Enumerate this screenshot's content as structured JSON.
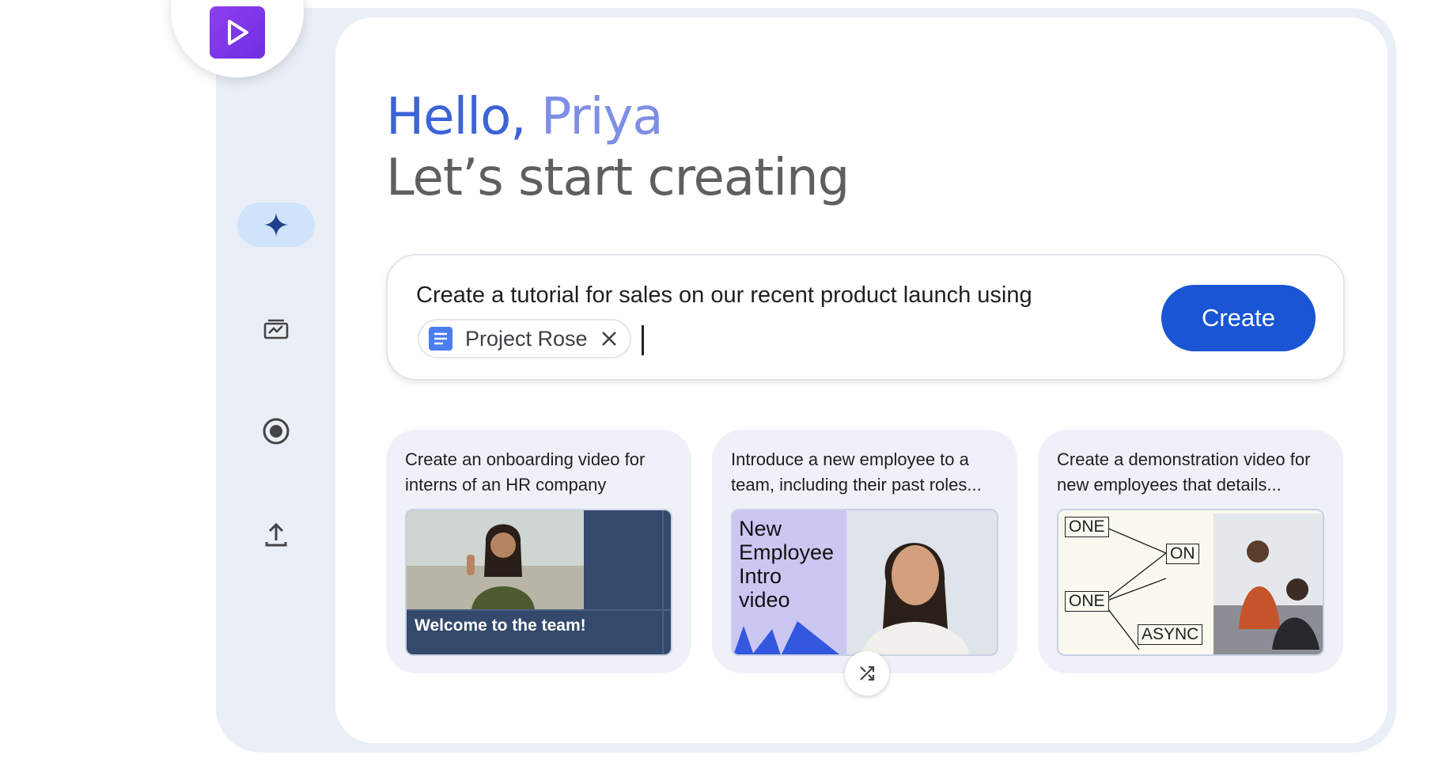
{
  "greeting": {
    "hello": "Hello,",
    "name": "Priya",
    "subtitle": "Let’s start creating"
  },
  "rail": {
    "items": [
      {
        "icon": "sparkle-icon",
        "active": true
      },
      {
        "icon": "edit-gallery-icon",
        "active": false
      },
      {
        "icon": "record-icon",
        "active": false
      },
      {
        "icon": "upload-icon",
        "active": false
      }
    ]
  },
  "prompt": {
    "text": "Create a tutorial for sales on our recent product launch using",
    "chip_label": "Project Rose",
    "create_label": "Create"
  },
  "suggestions": [
    {
      "text": "Create an onboarding video for interns of an HR company",
      "thumb_caption": "Welcome to the team!"
    },
    {
      "text": "Introduce a new employee to a team, including their past roles...",
      "thumb_lines": [
        "New",
        "Employee",
        "Intro",
        "video"
      ]
    },
    {
      "text": "Create a demonstration video for new employees that details...",
      "thumb_words": [
        "ONE",
        "ON",
        "ONE",
        "ASYNC"
      ]
    }
  ],
  "colors": {
    "accent": "#1a55d4",
    "logo": "#8e3ff0",
    "rail_active": "#cfe3fb"
  }
}
